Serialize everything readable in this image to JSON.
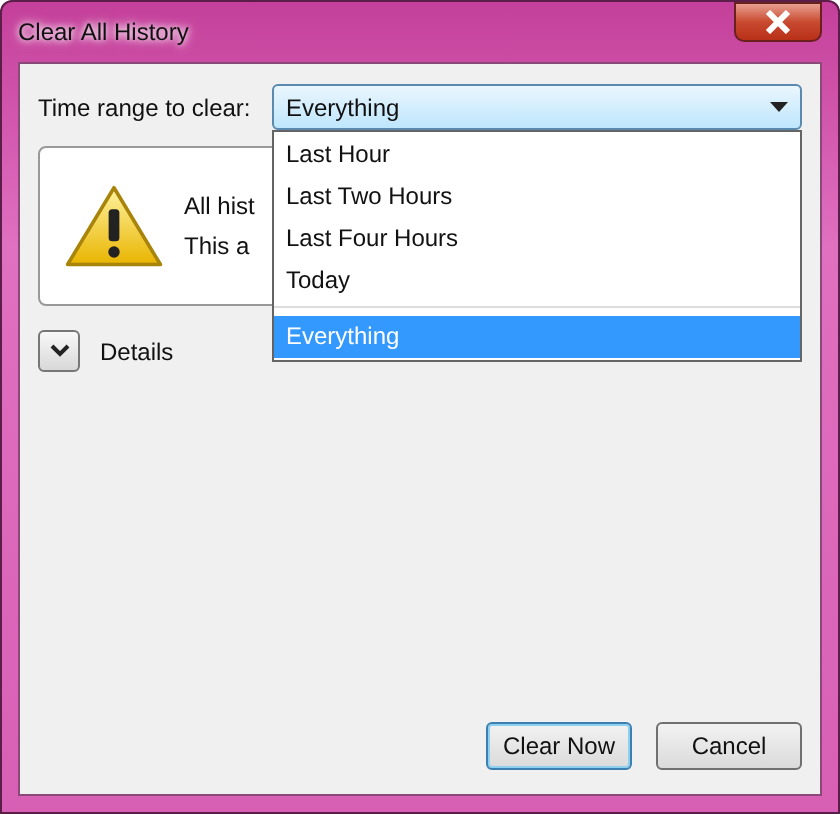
{
  "window": {
    "title": "Clear All History"
  },
  "time_range": {
    "label": "Time range to clear:",
    "value": "Everything",
    "open": true,
    "options": [
      {
        "label": "Last Hour",
        "selected": false
      },
      {
        "label": "Last Two Hours",
        "selected": false
      },
      {
        "label": "Last Four Hours",
        "selected": false
      },
      {
        "label": "Today",
        "selected": false
      },
      {
        "label": "Everything",
        "selected": true
      }
    ]
  },
  "warning": {
    "lines": [
      "All hist",
      "This a"
    ]
  },
  "details": {
    "label": "Details",
    "expanded": false
  },
  "buttons": [
    {
      "label": "Clear Now",
      "default": true
    },
    {
      "label": "Cancel",
      "default": false
    }
  ]
}
